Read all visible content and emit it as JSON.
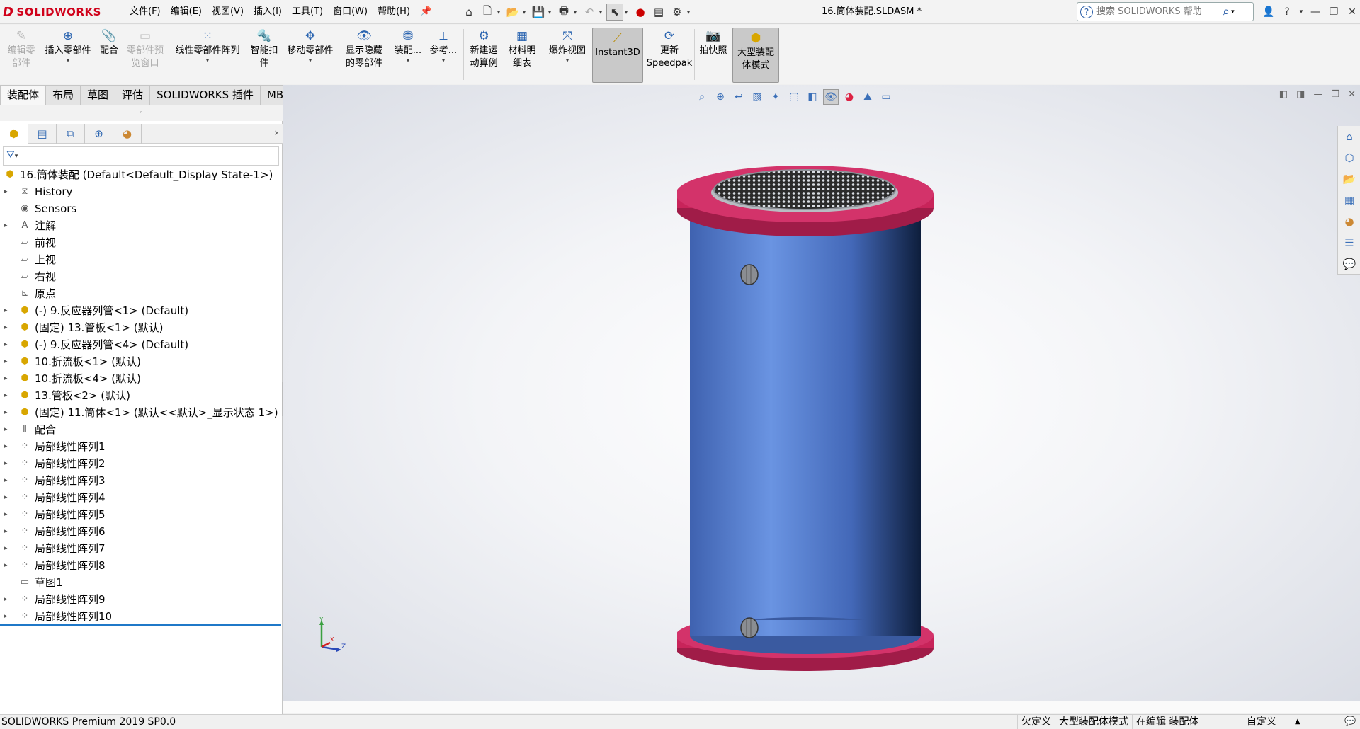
{
  "app": {
    "logo_text": "SOLIDWORKS",
    "document_title": "16.筒体装配.SLDASM *",
    "brand_color": "#d0021b"
  },
  "menubar": {
    "items": [
      "文件(F)",
      "编辑(E)",
      "视图(V)",
      "插入(I)",
      "工具(T)",
      "窗口(W)",
      "帮助(H)"
    ]
  },
  "search": {
    "placeholder": "搜索 SOLIDWORKS 帮助"
  },
  "commands": {
    "edit_component": "编辑零\n部件",
    "insert_components": "插入零部件",
    "mate": "配合",
    "component_preview": "零部件预\n览窗口",
    "linear_pattern": "线性零部件阵列",
    "smart_fasteners": "智能扣\n件",
    "move_component": "移动零部件",
    "show_hidden": "显示隐藏\n的零部件",
    "assembly_features": "装配...",
    "reference_geometry": "参考...",
    "new_motion_study": "新建运\n动算例",
    "bill_of_materials": "材料明\n细表",
    "exploded_view": "爆炸视图",
    "instant3d": "Instant3D",
    "update_speedpak": "更新\nSpeedpak",
    "take_snapshot": "拍快照",
    "large_assembly_mode": "大型装配\n体模式"
  },
  "tabs": [
    "装配体",
    "布局",
    "草图",
    "评估",
    "SOLIDWORKS 插件",
    "MBD"
  ],
  "tree": {
    "root": "16.筒体装配  (Default<Default_Display State-1>)",
    "items": [
      {
        "label": "History",
        "icon": "history-folder-icon",
        "expandable": true
      },
      {
        "label": "Sensors",
        "icon": "sensors-folder-icon",
        "expandable": false
      },
      {
        "label": "注解",
        "icon": "annotations-icon",
        "expandable": true
      },
      {
        "label": "前视",
        "icon": "plane-icon",
        "expandable": false
      },
      {
        "label": "上视",
        "icon": "plane-icon",
        "expandable": false
      },
      {
        "label": "右视",
        "icon": "plane-icon",
        "expandable": false
      },
      {
        "label": "原点",
        "icon": "origin-icon",
        "expandable": false
      },
      {
        "label": "(-) 9.反应器列管<1> (Default)",
        "icon": "part-icon",
        "expandable": true
      },
      {
        "label": "(固定) 13.管板<1> (默认)",
        "icon": "part-icon",
        "expandable": true
      },
      {
        "label": "(-) 9.反应器列管<4> (Default)",
        "icon": "part-icon",
        "expandable": true
      },
      {
        "label": "10.折流板<1> (默认)",
        "icon": "part-icon",
        "expandable": true
      },
      {
        "label": "10.折流板<4> (默认)",
        "icon": "part-icon",
        "expandable": true
      },
      {
        "label": "13.管板<2> (默认)",
        "icon": "part-icon",
        "expandable": true
      },
      {
        "label": "(固定) 11.筒体<1> (默认<<默认>_显示状态 1>)",
        "icon": "part-icon",
        "expandable": true
      },
      {
        "label": "配合",
        "icon": "mates-icon",
        "expandable": true
      },
      {
        "label": "局部线性阵列1",
        "icon": "pattern-icon",
        "expandable": true
      },
      {
        "label": "局部线性阵列2",
        "icon": "pattern-icon",
        "expandable": true
      },
      {
        "label": "局部线性阵列3",
        "icon": "pattern-icon",
        "expandable": true
      },
      {
        "label": "局部线性阵列4",
        "icon": "pattern-icon",
        "expandable": true
      },
      {
        "label": "局部线性阵列5",
        "icon": "pattern-icon",
        "expandable": true
      },
      {
        "label": "局部线性阵列6",
        "icon": "pattern-icon",
        "expandable": true
      },
      {
        "label": "局部线性阵列7",
        "icon": "pattern-icon",
        "expandable": true
      },
      {
        "label": "局部线性阵列8",
        "icon": "pattern-icon",
        "expandable": true
      },
      {
        "label": "草图1",
        "icon": "sketch-icon",
        "expandable": false
      },
      {
        "label": "局部线性阵列9",
        "icon": "pattern-icon",
        "expandable": true
      },
      {
        "label": "局部线性阵列10",
        "icon": "pattern-icon",
        "expandable": true
      }
    ]
  },
  "triad": {
    "y": "Y",
    "x": "X",
    "z": "Z"
  },
  "model_colors": {
    "shell": "#5b88d8",
    "flange": "#c8245a",
    "tubesheet": "#9aa0a8"
  },
  "status": {
    "product": "SOLIDWORKS Premium 2019 SP0.0",
    "underdefined": "欠定义",
    "large_asm_mode": "大型装配体模式",
    "editing": "在编辑 装配体",
    "custom": "自定义"
  }
}
